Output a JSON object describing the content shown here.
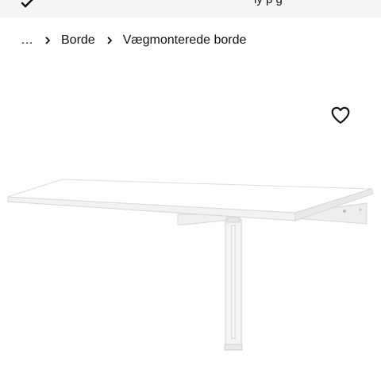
{
  "topbar": {
    "back_icon": "back-arrow-icon",
    "text": "ly      p      g"
  },
  "breadcrumb": {
    "ellipsis": "…",
    "items": [
      "Borde",
      "Vægmonterede borde"
    ],
    "separator_icon": "chevron-right-icon"
  },
  "product": {
    "favorite_icon": "heart-icon",
    "image_subject": "wall-mounted drop-leaf table",
    "image_color": "#ffffff"
  }
}
